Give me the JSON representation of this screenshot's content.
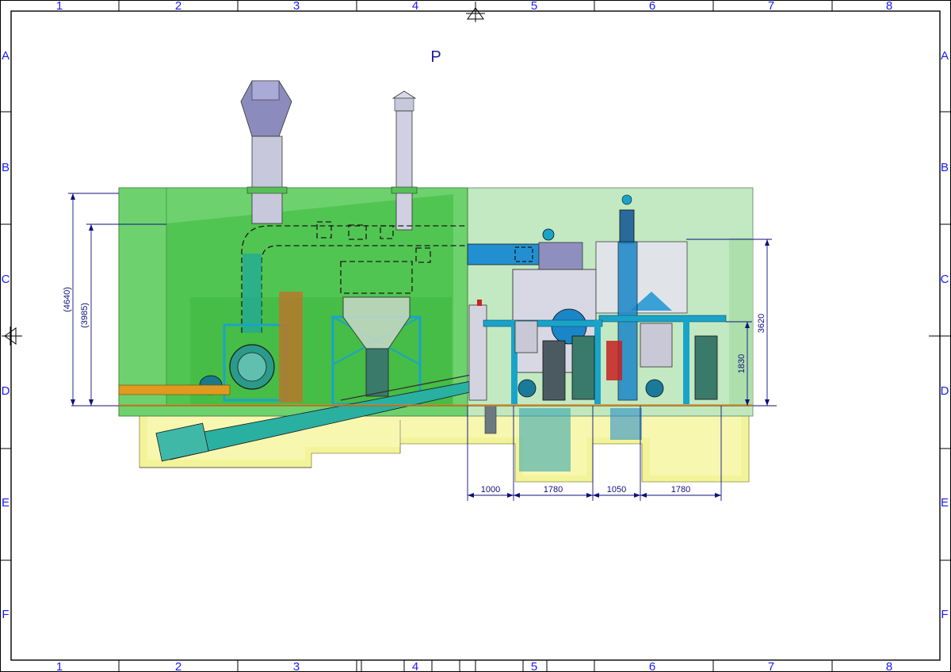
{
  "frame": {
    "columns": [
      "1",
      "2",
      "3",
      "4",
      "5",
      "6",
      "7",
      "8"
    ],
    "rows": [
      "A",
      "B",
      "C",
      "D",
      "E",
      "F"
    ]
  },
  "view_label": "P",
  "dimensions": {
    "overall_height": "(4640)",
    "inner_height": "(3985)",
    "right_height": "3620",
    "mid_height": "1830",
    "span_1": "1000",
    "span_2": "1780",
    "span_3": "1050",
    "span_4": "1780"
  },
  "colors": {
    "border": "#000000",
    "zone_label": "#1a1aff",
    "dimension": "#10107a",
    "enclosure_left": "#5fcf5f",
    "enclosure_right": "#bfe8bf",
    "foundation": "#f3f39a",
    "steel_frame": "#1aa3c8",
    "stack": "#c8c8dc"
  }
}
